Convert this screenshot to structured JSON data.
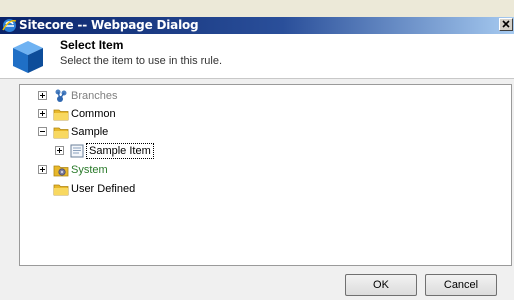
{
  "window": {
    "title": "Sitecore -- Webpage Dialog",
    "close_icon": "close-icon"
  },
  "header": {
    "title": "Select Item",
    "subtitle": "Select the item to use in this rule.",
    "icon": "blue-cube-icon"
  },
  "tree": {
    "items": [
      {
        "label": "Branches",
        "icon": "branches-icon",
        "expander": "plus",
        "color": "#808080"
      },
      {
        "label": "Common",
        "icon": "folder-icon",
        "expander": "plus",
        "color": "#000000"
      },
      {
        "label": "Sample",
        "icon": "folder-icon",
        "expander": "minus",
        "color": "#000000"
      },
      {
        "label": "Sample Item",
        "icon": "document-icon",
        "expander": "plus",
        "color": "#000000",
        "selected": true
      },
      {
        "label": "System",
        "icon": "system-icon",
        "expander": "plus",
        "color": "#2a7a2a"
      },
      {
        "label": "User Defined",
        "icon": "folder-icon",
        "expander": "none",
        "color": "#000000"
      }
    ]
  },
  "buttons": {
    "ok_label": "OK",
    "cancel_label": "Cancel"
  }
}
